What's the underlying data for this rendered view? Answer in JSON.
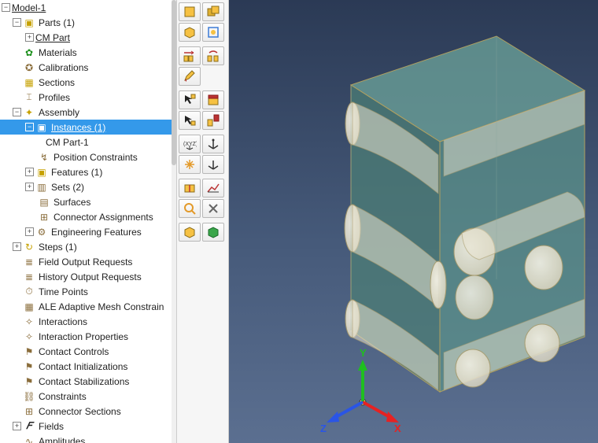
{
  "tree": {
    "root_label": "Model-1",
    "parts_label": "Parts (1)",
    "cm_part_label": "CM Part",
    "materials_label": "Materials",
    "calibrations_label": "Calibrations",
    "sections_label": "Sections",
    "profiles_label": "Profiles",
    "assembly_label": "Assembly",
    "instances_label": "Instances (1)",
    "cm_part1_label": "CM Part-1",
    "position_constraints_label": "Position Constraints",
    "features_label": "Features (1)",
    "sets_label": "Sets (2)",
    "surfaces_label": "Surfaces",
    "connector_assignments_label": "Connector Assignments",
    "engineering_features_label": "Engineering Features",
    "steps_label": "Steps (1)",
    "field_output_label": "Field Output Requests",
    "history_output_label": "History Output Requests",
    "time_points_label": "Time Points",
    "ale_label": "ALE Adaptive Mesh Constrain",
    "interactions_label": "Interactions",
    "interaction_props_label": "Interaction Properties",
    "contact_controls_label": "Contact Controls",
    "contact_init_label": "Contact Initializations",
    "contact_stab_label": "Contact Stabilizations",
    "constraints_label": "Constraints",
    "connector_sections_label": "Connector Sections",
    "fields_label": "Fields",
    "amplitudes_label": "Amplitudes"
  },
  "toolbar": {
    "g1a": "create-part",
    "g1b": "part-manager",
    "g2a": "create-instance",
    "g2b": "instance-tool",
    "g3a": "linear-pattern",
    "g3b": "radial-pattern",
    "g4a": "edit-tool",
    "g5a": "select-options",
    "g5b": "highlight",
    "g6a": "translate",
    "g6b": "rotate",
    "g7a": "datum-csys",
    "g7b": "datum-point",
    "g8a": "merge",
    "g8b": "mesh",
    "g9a": "partition",
    "g9b": "wireframe",
    "g10a": "query",
    "g10b": "tools",
    "g11a": "color-code",
    "g11b": "visibility"
  },
  "viewport": {
    "triad": {
      "x": "X",
      "y": "Y",
      "z": "Z"
    }
  }
}
